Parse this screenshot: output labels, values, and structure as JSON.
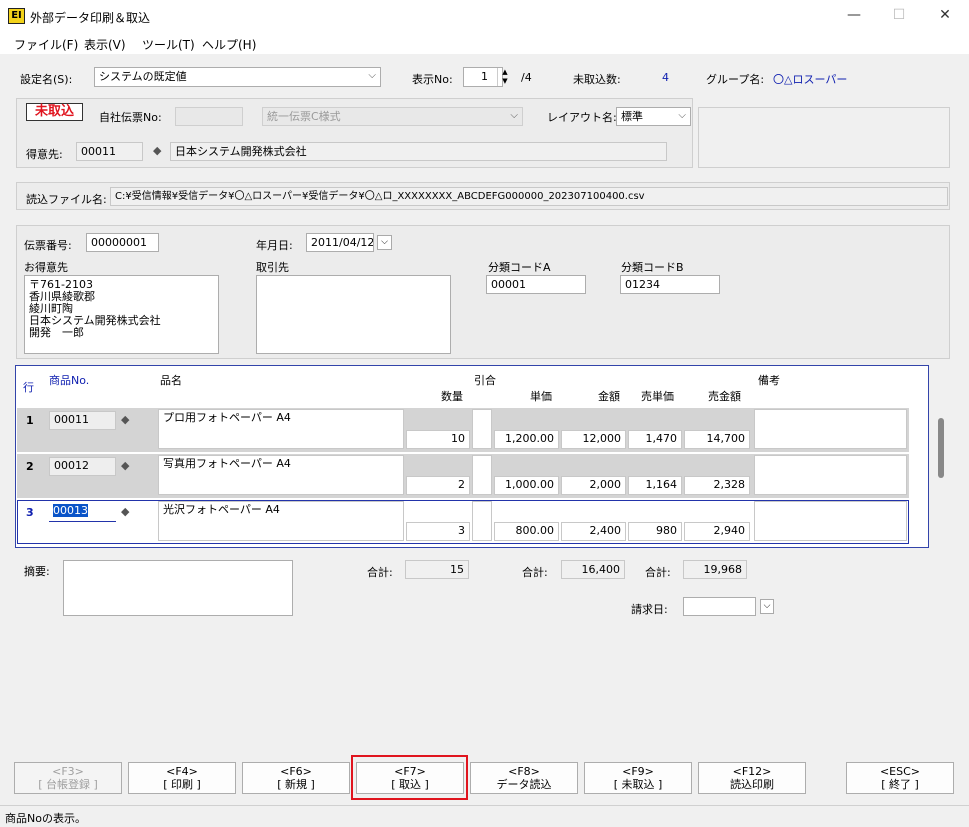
{
  "window": {
    "title": "外部データ印刷＆取込",
    "icon": "app-logo-icon",
    "minimize": "—",
    "maximize": "☐",
    "close": "✕"
  },
  "menu": [
    "ファイル(F)",
    "表示(V)",
    "ツール(T)",
    "ヘルプ(H)"
  ],
  "top": {
    "setting_label": "設定名(S):",
    "setting_value": "システムの既定値",
    "display_label": "表示No:",
    "display_value": "1",
    "display_total": "/4",
    "unimported_label": "未取込数:",
    "unimported_value": "4",
    "group_label": "グループ名:",
    "group_value": "〇△ロスーパー"
  },
  "status_badge": "未取込",
  "header": {
    "voucher_label": "自社伝票No:",
    "voucher_value": "",
    "form_value": "統一伝票C様式",
    "layout_label": "レイアウト名:",
    "layout_value": "標準",
    "customer_label": "得意先:",
    "customer_code": "00011",
    "customer_name": "日本システム開発株式会社"
  },
  "file": {
    "label": "読込ファイル名:",
    "path": "C:¥受信情報¥受信データ¥〇△ロスーパー¥受信データ¥〇△ロ_XXXXXXXX_ABCDEFG000000_202307100400.csv"
  },
  "detail": {
    "slip_label": "伝票番号:",
    "slip_value": "00000001",
    "date_label": "年月日:",
    "date_value": "2011/04/12",
    "customer_label": "お得意先",
    "customer_lines": [
      "〒761-2103",
      "香川県綾歌郡",
      "綾川町陶",
      "日本システム開発株式会社",
      "開発　一郎"
    ],
    "supplier_label": "取引先",
    "codeA_label": "分類コードA",
    "codeA_value": "00001",
    "codeB_label": "分類コードB",
    "codeB_value": "01234"
  },
  "grid": {
    "headers": {
      "row": "行",
      "code": "商品No.",
      "name": "品名",
      "hikiai": "引合",
      "qty": "数量",
      "unit": "単価",
      "amount": "金額",
      "sale_unit": "売単価",
      "sale_amount": "売金額",
      "note": "備考"
    },
    "rows": [
      {
        "no": "1",
        "code": "00011",
        "name": "プロ用フォトペーパー A4",
        "qty": "10",
        "unit": "1,200.00",
        "amount": "12,000",
        "sale_unit": "1,470",
        "sale_amount": "14,700"
      },
      {
        "no": "2",
        "code": "00012",
        "name": "写真用フォトペーパー A4",
        "qty": "2",
        "unit": "1,000.00",
        "amount": "2,000",
        "sale_unit": "1,164",
        "sale_amount": "2,328"
      },
      {
        "no": "3",
        "code": "00013",
        "name": "光沢フォトペーパー A4",
        "qty": "3",
        "unit": "800.00",
        "amount": "2,400",
        "sale_unit": "980",
        "sale_amount": "2,940"
      }
    ]
  },
  "footer": {
    "memo_label": "摘要:",
    "total_label": "合計:",
    "total_qty": "15",
    "total_amount": "16,400",
    "total_sale": "19,968",
    "billing_label": "請求日:"
  },
  "fkeys": [
    {
      "key": "<F3>",
      "label": "[ 台帳登録 ]",
      "enabled": false
    },
    {
      "key": "<F4>",
      "label": "[ 印刷 ]",
      "enabled": true
    },
    {
      "key": "<F6>",
      "label": "[ 新規 ]",
      "enabled": true
    },
    {
      "key": "<F7>",
      "label": "[ 取込 ]",
      "enabled": true
    },
    {
      "key": "<F8>",
      "label": "データ読込",
      "enabled": true
    },
    {
      "key": "<F9>",
      "label": "[ 未取込 ]",
      "enabled": true
    },
    {
      "key": "<F12>",
      "label": "読込印刷",
      "enabled": true
    },
    {
      "key": "<ESC>",
      "label": "[ 終了 ]",
      "enabled": true
    }
  ],
  "status": "商品Noの表示。",
  "colors": {
    "accent": "#1020b0",
    "badge": "#e0141e",
    "highlight": "#e0141e"
  }
}
